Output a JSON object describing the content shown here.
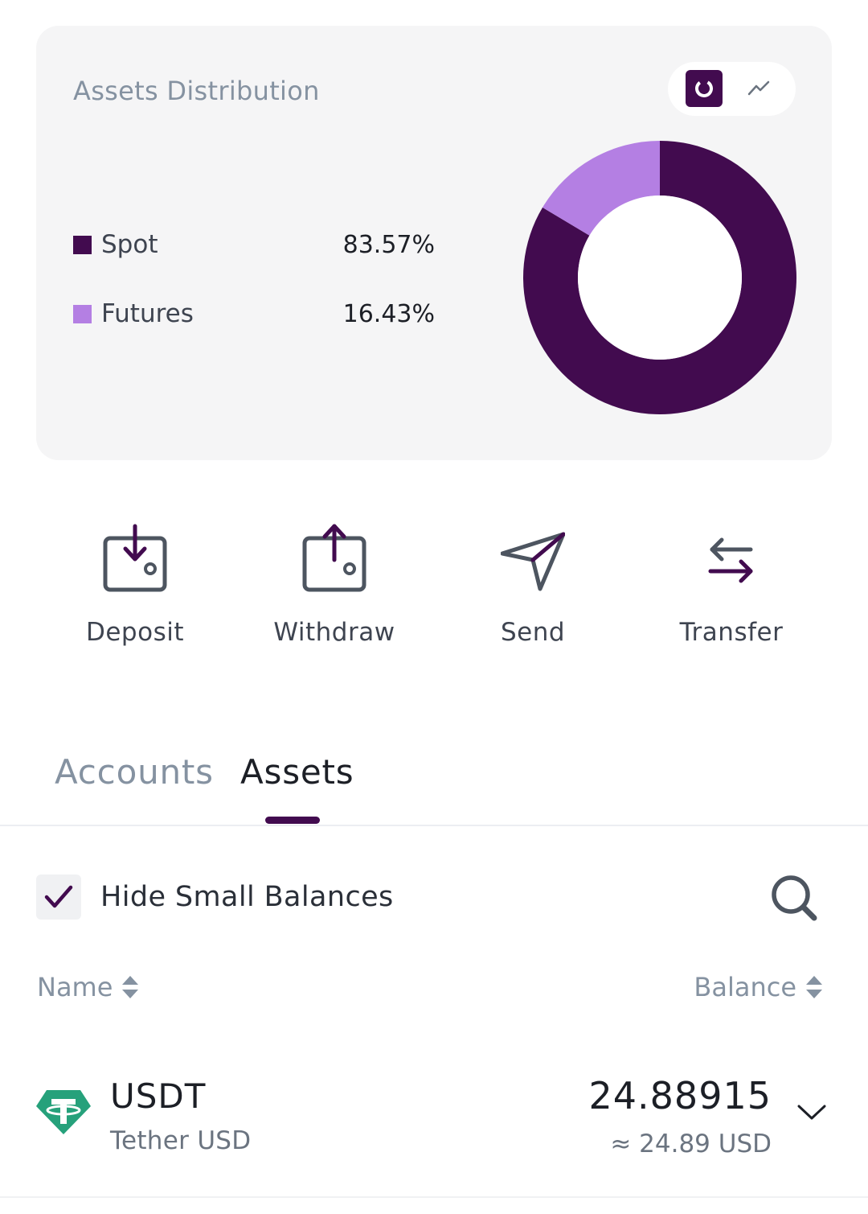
{
  "distribution": {
    "title": "Assets Distribution",
    "toggle": {
      "donut_icon": "donut-chart-icon",
      "line_icon": "line-chart-icon",
      "active": "donut"
    },
    "accent_color": "#420b4f"
  },
  "chart_data": {
    "type": "pie",
    "variant": "donut",
    "categories": [
      "Spot",
      "Futures"
    ],
    "values": [
      83.57,
      16.43
    ],
    "labels": [
      "83.57%",
      "16.43%"
    ],
    "colors": [
      "#420b4f",
      "#b47fe3"
    ],
    "legend": "left"
  },
  "actions": [
    {
      "label": "Deposit",
      "icon": "deposit-wallet-icon"
    },
    {
      "label": "Withdraw",
      "icon": "withdraw-wallet-icon"
    },
    {
      "label": "Send",
      "icon": "send-plane-icon"
    },
    {
      "label": "Transfer",
      "icon": "transfer-arrows-icon"
    }
  ],
  "tabs": [
    {
      "label": "Accounts",
      "active": false
    },
    {
      "label": "Assets",
      "active": true
    }
  ],
  "filter": {
    "label": "Hide Small Balances",
    "checked": true
  },
  "table": {
    "headers": {
      "name": "Name",
      "balance": "Balance"
    },
    "rows": [
      {
        "symbol": "USDT",
        "name": "Tether USD",
        "balance": "24.88915",
        "usd": "≈ 24.89 USD",
        "icon": "tether-icon"
      }
    ]
  }
}
